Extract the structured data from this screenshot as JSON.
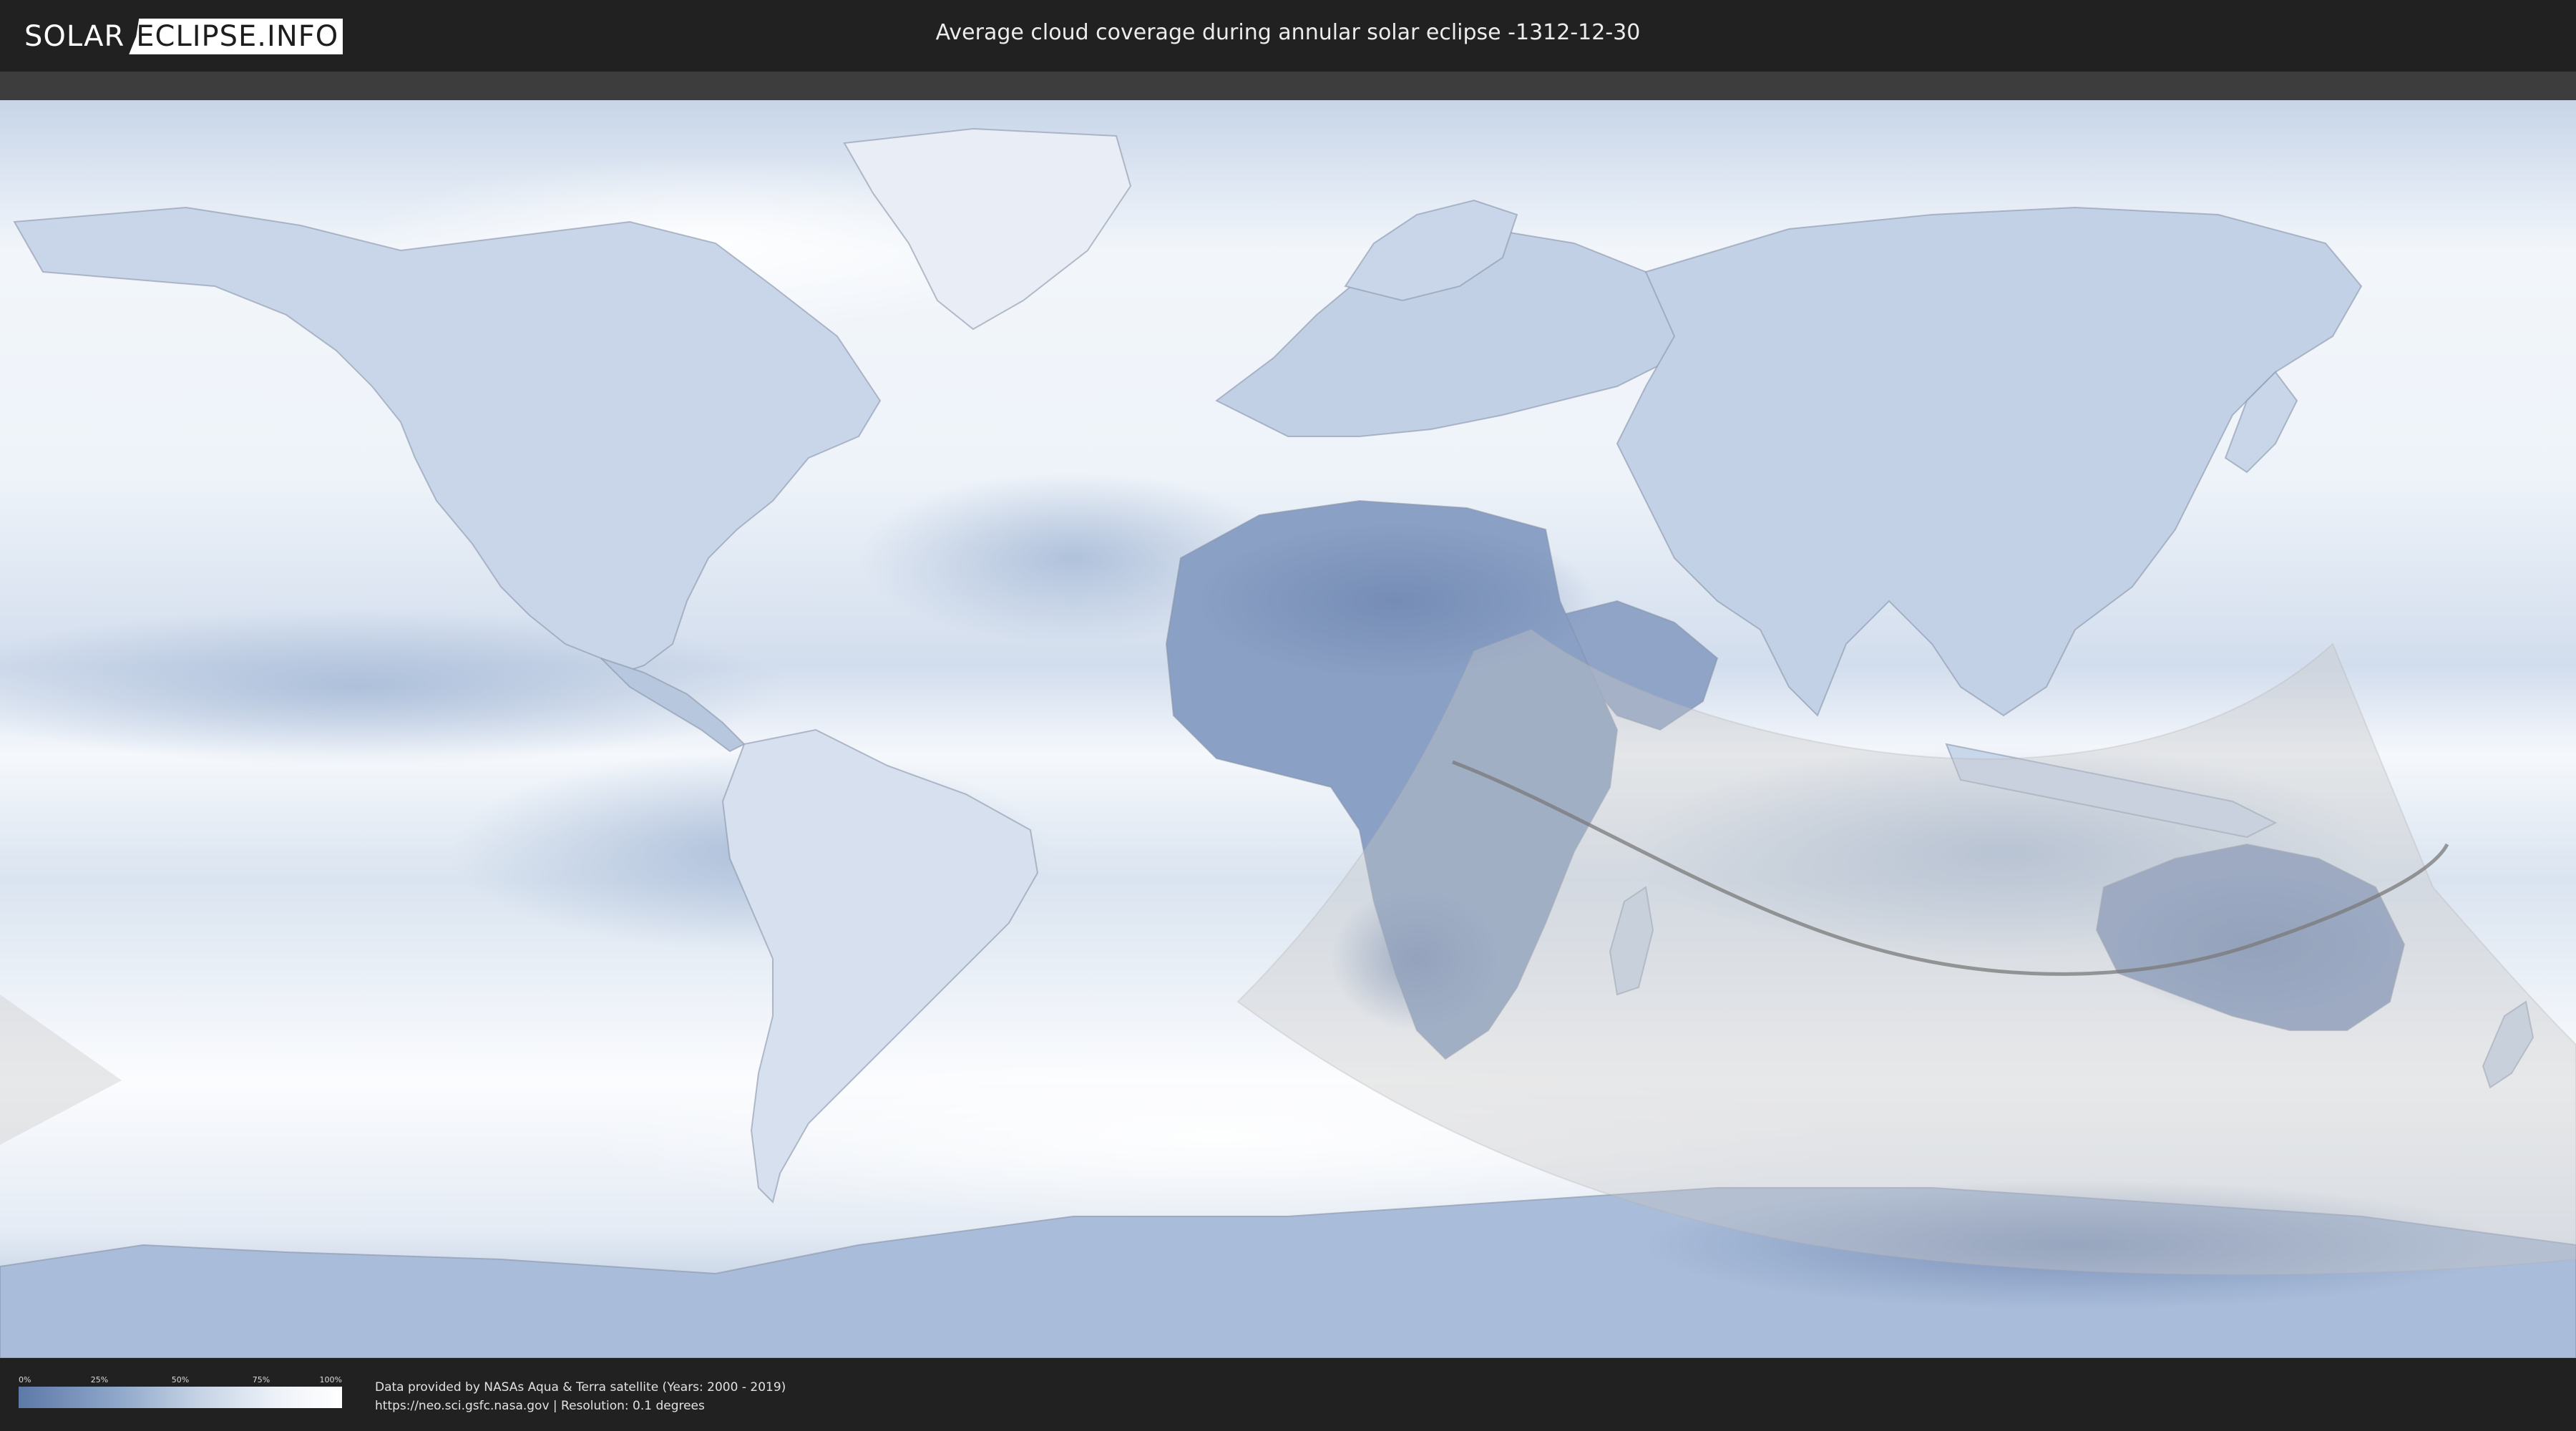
{
  "header": {
    "logo_left": "SOLAR",
    "logo_right": "ECLIPSE.INFO",
    "title": "Average cloud coverage during annular solar eclipse -1312-12-30"
  },
  "legend": {
    "ticks": [
      "0%",
      "25%",
      "50%",
      "75%",
      "100%"
    ],
    "colors": {
      "low": "#5d79a7",
      "high": "#ffffff"
    }
  },
  "credits": {
    "line1": "Data provided by NASAs Aqua & Terra satellite (Years: 2000 - 2019)",
    "line2": "https://neo.sci.gsfc.nasa.gov | Resolution: 0.1 degrees"
  },
  "map": {
    "projection": "equirectangular",
    "ocean_color": "#dfe8f3",
    "cloud_dark_color": "#7e97bf",
    "eclipse_zone_color": "#c8c8c8",
    "central_line_color": "#7a7a7a"
  }
}
